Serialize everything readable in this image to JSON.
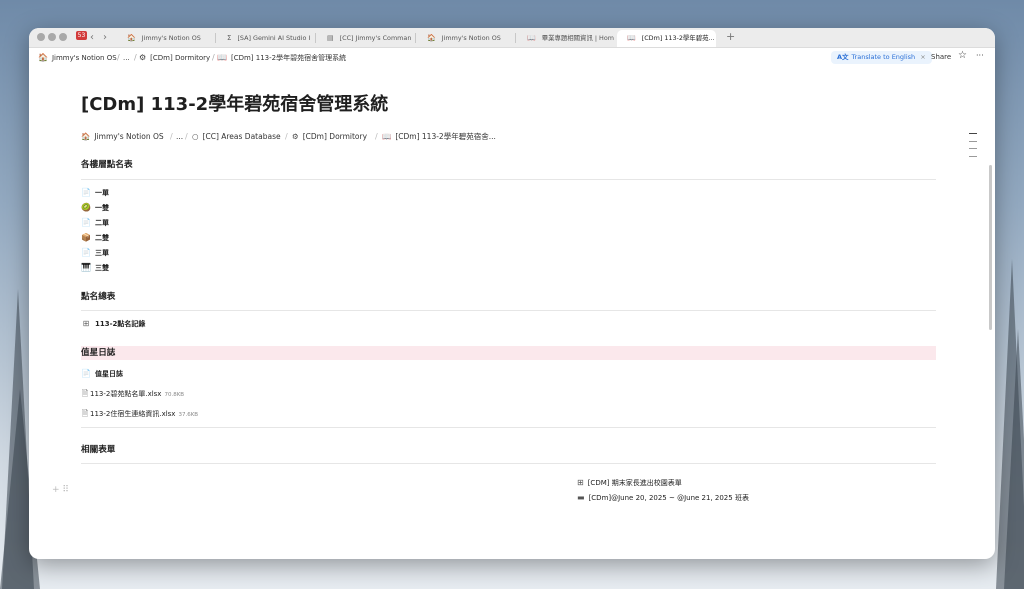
{
  "tabs": [
    {
      "icon": "🏠",
      "label": "Jimmy's Notion OS"
    },
    {
      "icon": "Σ",
      "label": "[SA] Gemini AI Studio I"
    },
    {
      "icon": "▤",
      "label": "[CC] Jimmy's Comman"
    },
    {
      "icon": "🏠",
      "label": "Jimmy's Notion OS"
    },
    {
      "icon": "📖",
      "label": "畢業專題相關資訊 | Home"
    },
    {
      "icon": "📖",
      "label": "[CDm] 113-2學年碧苑..."
    }
  ],
  "tab_badge": "53",
  "new_tab_label": "+",
  "topbar": {
    "crumbs": [
      {
        "icon": "🏠",
        "label": "Jimmy's Notion OS"
      },
      {
        "icon": "",
        "label": "..."
      },
      {
        "icon": "⚙",
        "label": "[CDm] Dormitory"
      },
      {
        "icon": "📖",
        "label": "[CDm] 113-2學年碧苑宿舍管理系統"
      }
    ],
    "translate_label": "Translate to English",
    "translate_icon": "A文",
    "translate_close": "×",
    "share_label": "Share",
    "star_icon": "☆",
    "more_icon": "···"
  },
  "page": {
    "title": "[CDm] 113-2學年碧苑宿舍管理系統",
    "breadcrumbs": [
      {
        "icon": "🏠",
        "label": "Jimmy's Notion OS"
      },
      {
        "icon": "",
        "label": "..."
      },
      {
        "icon": "○",
        "label": "[CC] Areas Database"
      },
      {
        "icon": "⚙",
        "label": "[CDm] Dormitory"
      },
      {
        "icon": "📖",
        "label": "[CDm] 113-2學年碧苑宿舍..."
      }
    ],
    "sections": {
      "floors": {
        "heading": "各樓層點名表",
        "items": [
          {
            "icon": "📄",
            "label": "一單"
          },
          {
            "icon": "🥝",
            "label": "一雙"
          },
          {
            "icon": "📄",
            "label": "二單"
          },
          {
            "icon": "📦",
            "label": "二雙"
          },
          {
            "icon": "📄",
            "label": "三單"
          },
          {
            "icon": "🎹",
            "label": "三雙"
          }
        ]
      },
      "summary": {
        "heading": "點名總表",
        "items": [
          {
            "icon": "⊞",
            "label": "113-2點名記錄"
          }
        ]
      },
      "duty": {
        "heading": "值星日誌",
        "items": [
          {
            "icon": "📄",
            "label": "值星日誌"
          }
        ],
        "files": [
          {
            "icon": "🗎",
            "label": "113-2碧苑點名單.xlsx",
            "size": "70.8KB"
          },
          {
            "icon": "🗎",
            "label": "113-2住宿生連絡資訊.xlsx",
            "size": "37.6KB"
          }
        ]
      },
      "related": {
        "heading": "相關表單",
        "items": [
          {
            "icon": "⊞",
            "label": "[CDM] 期末家長進出校園表單"
          },
          {
            "icon": "▬",
            "label": "[CDm]@June 20, 2025 ~ @June 21, 2025 班表"
          }
        ]
      }
    },
    "block_handles": "+ ⠿",
    "assistant_icon": "ᘘ"
  }
}
